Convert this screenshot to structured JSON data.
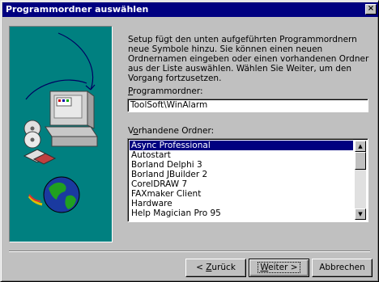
{
  "window": {
    "title": "Programmordner auswählen",
    "close_glyph": "×"
  },
  "description": "Setup fügt den unten aufgeführten Programmordnern neue Symbole hinzu. Sie können einen neuen Ordnernamen eingeben oder einen vorhandenen Ordner aus der Liste auswählen. Wählen Sie Weiter, um den Vorgang fortzusetzen.",
  "program_folder": {
    "label_pre": "",
    "label_key": "P",
    "label_post": "rogrammordner:",
    "value": "ToolSoft\\WinAlarm"
  },
  "existing_folders": {
    "label_pre": "V",
    "label_key": "o",
    "label_post": "rhandene Ordner:",
    "items": [
      "Async Professional",
      "Autostart",
      "Borland Delphi 3",
      "Borland JBuilder 2",
      "CorelDRAW 7",
      "FAXmaker Client",
      "Hardware",
      "Help Magician Pro 95"
    ],
    "selected_index": 0
  },
  "buttons": {
    "back_pre": "< ",
    "back_key": "Z",
    "back_post": "urück",
    "next_key": "W",
    "next_post": "eiter >",
    "cancel": "Abbrechen"
  },
  "icons": {
    "art": "computer-globe-cd-illustration",
    "scroll_up": "arrow-up-icon",
    "scroll_down": "arrow-down-icon"
  }
}
